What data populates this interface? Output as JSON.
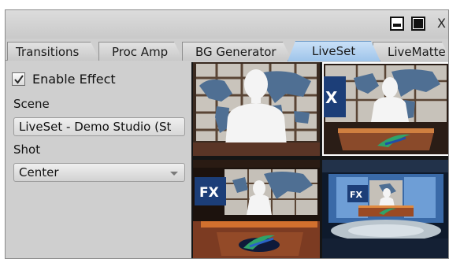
{
  "window": {
    "controls": {
      "minimize_icon": "minimize-icon",
      "maximize_icon": "maximize-icon",
      "close_label": "X"
    }
  },
  "tabs": [
    {
      "label": "Transitions",
      "active": false
    },
    {
      "label": "Proc Amp",
      "active": false
    },
    {
      "label": "BG Generator",
      "active": false
    },
    {
      "label": "LiveSet",
      "active": true
    },
    {
      "label": "LiveMatte",
      "active": false
    }
  ],
  "effect": {
    "enable_label": "Enable Effect",
    "enabled": true
  },
  "scene": {
    "label": "Scene",
    "value": "LiveSet - Demo Studio (St"
  },
  "shot": {
    "label": "Shot",
    "value": "Center"
  },
  "shots": [
    {
      "name": "center",
      "selected": false
    },
    {
      "name": "right",
      "selected": true,
      "badge": "X"
    },
    {
      "name": "wide-left",
      "selected": false,
      "badge": "FX"
    },
    {
      "name": "wide",
      "selected": false,
      "badge": "FX"
    }
  ],
  "colors": {
    "active_tab": "#a8cbee",
    "panel": "#cfcfcf",
    "studio_accent": "#c4481c"
  }
}
